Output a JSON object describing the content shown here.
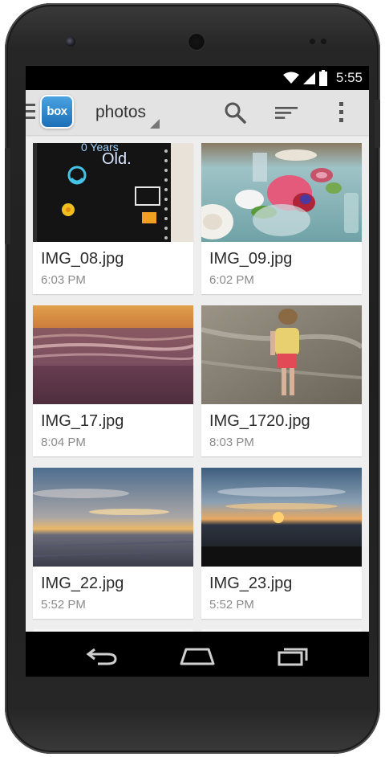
{
  "status_bar": {
    "time": "5:55",
    "icons": [
      "wifi-icon",
      "signal-icon",
      "battery-icon"
    ]
  },
  "action_bar": {
    "logo_text": "box",
    "title": "photos",
    "icons": [
      "menu-icon",
      "search-icon",
      "sort-icon",
      "overflow-menu-icon"
    ]
  },
  "files": [
    {
      "name": "IMG_08.jpg",
      "time": "6:03 PM"
    },
    {
      "name": "IMG_09.jpg",
      "time": "6:02 PM"
    },
    {
      "name": "IMG_17.jpg",
      "time": "8:04 PM"
    },
    {
      "name": "IMG_1720.jpg",
      "time": "8:03 PM"
    },
    {
      "name": "IMG_22.jpg",
      "time": "5:52 PM"
    },
    {
      "name": "IMG_23.jpg",
      "time": "5:52 PM"
    }
  ],
  "nav_bar": {
    "icons": [
      "back-icon",
      "home-icon",
      "recents-icon"
    ]
  },
  "colors": {
    "action_bar_bg": "#e3e3e3",
    "screen_bg": "#eeeeee",
    "box_brand": "#1c6fb8"
  }
}
